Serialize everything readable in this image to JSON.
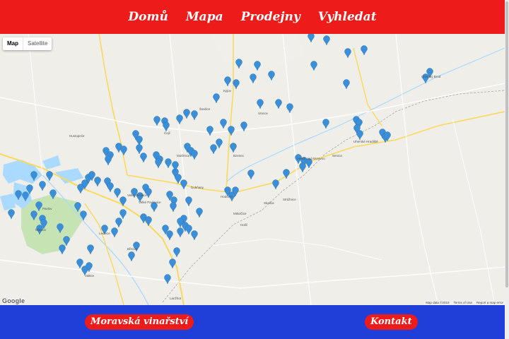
{
  "nav": {
    "home": "Domů",
    "map": "Mapa",
    "shops": "Prodejny",
    "search": "Vyhledat"
  },
  "map": {
    "type_map": "Map",
    "type_satellite": "Satellite",
    "logo": "Google",
    "footer_data": "Map data ©2019",
    "footer_terms": "Terms of Use",
    "footer_report": "Report a map error",
    "places": [
      "Mikulov",
      "Hodonín",
      "Břeclav",
      "Valtice",
      "Lednice",
      "Pavlov",
      "Strážnice",
      "Kyjov",
      "Uherský Brod",
      "Veselí nad Moravou",
      "Uherské Hradiště",
      "Hustopeče",
      "Čejč",
      "Velké Pavlovice",
      "Bzenec",
      "Mutěnice",
      "Dubňany",
      "Lanžhot",
      "Skalica",
      "Holíč",
      "Senica",
      "Šardice",
      "Vracov",
      "Velké Bílovice",
      "Mikulčice"
    ]
  },
  "footer": {
    "wineries": "Moravská vinařství",
    "contact": "Kontakt"
  },
  "colors": {
    "header_red": "#ee1b1b",
    "footer_blue": "#1f3fd8",
    "marker_blue": "#3b8ed8",
    "park_green": "#c5e3b3",
    "water_blue": "#aadaff",
    "road_yellow": "#fbd95c"
  },
  "icons": {
    "marker": "map-pin-icon"
  }
}
